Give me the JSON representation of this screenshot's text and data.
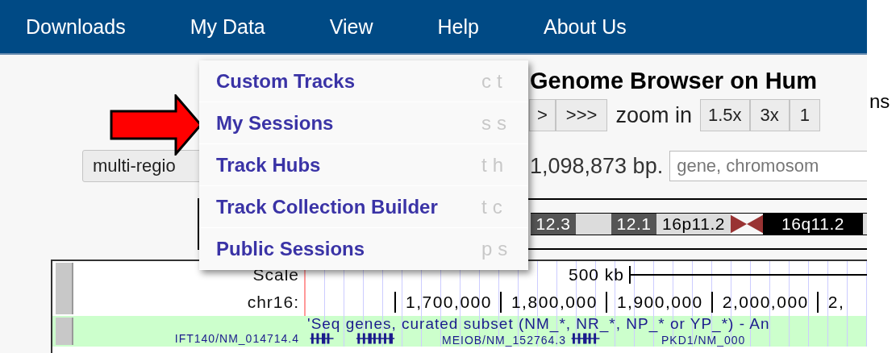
{
  "nav": [
    {
      "label": "Downloads"
    },
    {
      "label": "My Data"
    },
    {
      "label": "View"
    },
    {
      "label": "Help"
    },
    {
      "label": "About Us"
    }
  ],
  "menu": {
    "items": [
      {
        "label": "Custom Tracks",
        "shortcut": "ct"
      },
      {
        "label": "My Sessions",
        "shortcut": "ss"
      },
      {
        "label": "Track Hubs",
        "shortcut": "th"
      },
      {
        "label": "Track Collection Builder",
        "shortcut": "tc"
      },
      {
        "label": "Public Sessions",
        "shortcut": "ps"
      }
    ]
  },
  "title": "Genome Browser on Hum",
  "move_buttons": [
    ">",
    ">>>"
  ],
  "zoom_label": "zoom in",
  "zoom_buttons": [
    "1.5x",
    "3x",
    "1"
  ],
  "multi_region_button": "multi-regio",
  "size_text": "1,098,873 bp.",
  "search": {
    "placeholder": "gene, chromosom"
  },
  "ideogram": [
    {
      "kind": "dark",
      "label": "12.3"
    },
    {
      "kind": "light"
    },
    {
      "kind": "dark",
      "label": "12.1"
    },
    {
      "kind": "light",
      "label": "16p11.2"
    },
    {
      "kind": "centromere"
    },
    {
      "kind": "black",
      "label": "16q11.2"
    },
    {
      "kind": "light"
    }
  ],
  "tracks": {
    "scale_label": "Scale",
    "chrom_label": "chr16:",
    "scale_text": "500 kb",
    "ruler": [
      "1,700,000",
      "1,800,000",
      "1,900,000",
      "2,000,000",
      "2,"
    ],
    "gene_track": {
      "title": "'Seq genes, curated subset (NM_*, NR_*, NP_* or YP_*) - An",
      "left_label": "IFT140/NM_014714.4",
      "genes": [
        "MEIOB/NM_152764.3",
        "PKD1/NM_000"
      ]
    }
  },
  "side_text": "ns"
}
